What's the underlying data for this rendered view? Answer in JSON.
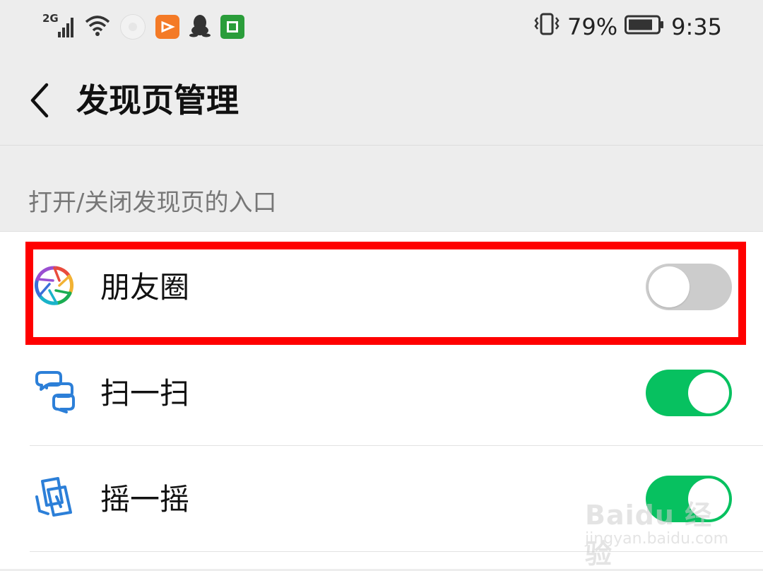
{
  "status_bar": {
    "network": "2G",
    "battery_percent": "79%",
    "time": "9:35",
    "left_icons": [
      "signal-icon",
      "wifi-icon",
      "notification-app-icon",
      "video-app-icon",
      "qq-icon",
      "green-app-icon"
    ],
    "right_icons": [
      "vibrate-icon",
      "battery-icon"
    ]
  },
  "header": {
    "title": "发现页管理",
    "back_icon": "chevron-left-icon"
  },
  "section": {
    "label": "打开/关闭发现页的入口"
  },
  "items": [
    {
      "label": "朋友圈",
      "icon": "moments-icon",
      "enabled": false
    },
    {
      "label": "扫一扫",
      "icon": "scan-icon",
      "enabled": true
    },
    {
      "label": "摇一摇",
      "icon": "shake-icon",
      "enabled": true
    }
  ],
  "watermark": {
    "main": "Baidu 经验",
    "sub": "jingyan.baidu.com"
  },
  "colors": {
    "toggle_on": "#07c160",
    "toggle_off": "#cccccc",
    "highlight": "#ff0000",
    "icon_blue": "#2c7fd8"
  }
}
